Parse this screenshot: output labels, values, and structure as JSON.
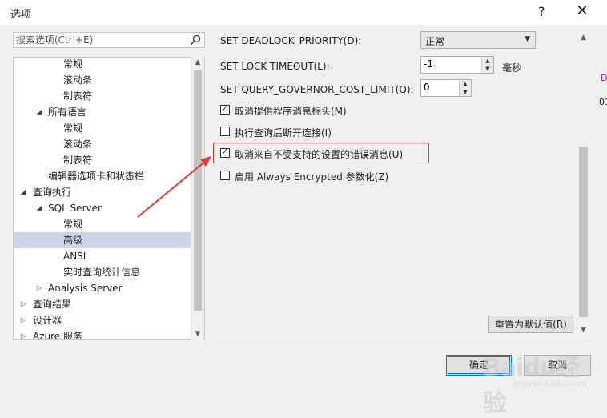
{
  "window": {
    "title": "选项",
    "help_label": "?",
    "close_label": "✕"
  },
  "search": {
    "placeholder": "搜索选项(Ctrl+E)"
  },
  "tree": {
    "items": [
      {
        "label": "常规",
        "indent": 3,
        "arrow": "",
        "selected": false
      },
      {
        "label": "滚动条",
        "indent": 3,
        "arrow": "",
        "selected": false
      },
      {
        "label": "制表符",
        "indent": 3,
        "arrow": "",
        "selected": false
      },
      {
        "label": "所有语言",
        "indent": 2,
        "arrow": "expanded",
        "selected": false
      },
      {
        "label": "常规",
        "indent": 3,
        "arrow": "",
        "selected": false
      },
      {
        "label": "滚动条",
        "indent": 3,
        "arrow": "",
        "selected": false
      },
      {
        "label": "制表符",
        "indent": 3,
        "arrow": "",
        "selected": false
      },
      {
        "label": "编辑器选项卡和状态栏",
        "indent": 2,
        "arrow": "",
        "selected": false
      },
      {
        "label": "查询执行",
        "indent": 1,
        "arrow": "expanded",
        "selected": false
      },
      {
        "label": "SQL Server",
        "indent": 2,
        "arrow": "expanded",
        "selected": false
      },
      {
        "label": "常规",
        "indent": 3,
        "arrow": "",
        "selected": false
      },
      {
        "label": "高级",
        "indent": 3,
        "arrow": "",
        "selected": true
      },
      {
        "label": "ANSI",
        "indent": 3,
        "arrow": "",
        "selected": false
      },
      {
        "label": "实时查询统计信息",
        "indent": 3,
        "arrow": "",
        "selected": false
      },
      {
        "label": "Analysis Server",
        "indent": 2,
        "arrow": "collapsed",
        "selected": false
      },
      {
        "label": "查询结果",
        "indent": 1,
        "arrow": "collapsed",
        "selected": false
      },
      {
        "label": "设计器",
        "indent": 1,
        "arrow": "collapsed",
        "selected": false
      },
      {
        "label": "Azure 服务",
        "indent": 1,
        "arrow": "collapsed",
        "selected": false
      }
    ]
  },
  "settings": {
    "deadlock_label": "SET DEADLOCK_PRIORITY(D):",
    "deadlock_value": "正常",
    "lock_timeout_label": "SET LOCK TIMEOUT(L):",
    "lock_timeout_value": "-1",
    "lock_timeout_unit": "毫秒",
    "governor_label": "SET QUERY_GOVERNOR_COST_LIMIT(Q):",
    "governor_value": "0"
  },
  "checkboxes": [
    {
      "label": "取消提供程序消息标头(M)",
      "checked": true
    },
    {
      "label": "执行查询后断开连接(I)",
      "checked": false
    },
    {
      "label": "取消来自不受支持的设置的错误消息(U)",
      "checked": true
    },
    {
      "label": "启用 Always Encrypted 参数化(Z)",
      "checked": false
    }
  ],
  "buttons": {
    "reset": "重置为默认值(R)",
    "ok": "确定",
    "cancel": "取消"
  },
  "background_edge": {
    "char1": "D",
    "char2": "01"
  },
  "annotation": {
    "color": "#e53935"
  },
  "watermark": {
    "text": "Baidu经验",
    "sub": "jingyan.baidu.com"
  }
}
